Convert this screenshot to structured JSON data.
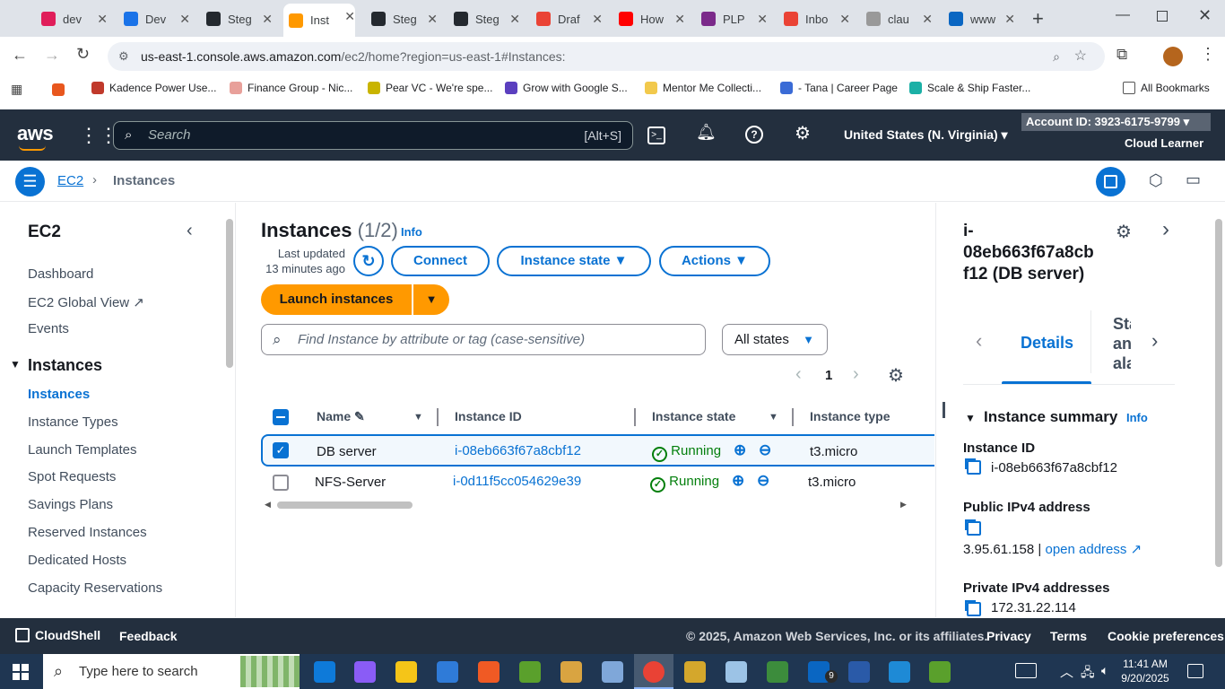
{
  "browser": {
    "tabs": [
      {
        "label": "dev",
        "color": "#e01e5a"
      },
      {
        "label": "Dev",
        "color": "#1a73e8"
      },
      {
        "label": "Steg",
        "color": "#24292f"
      },
      {
        "label": "Inst",
        "color": "#ff9900"
      },
      {
        "label": "Steg",
        "color": "#24292f"
      },
      {
        "label": "Steg",
        "color": "#24292f"
      },
      {
        "label": "Draf",
        "color": "#ea4335"
      },
      {
        "label": "How",
        "color": "#ff0000"
      },
      {
        "label": "PLP",
        "color": "#7b2a8a"
      },
      {
        "label": "Inbo",
        "color": "#ea4335"
      },
      {
        "label": "clau",
        "color": "#999999"
      },
      {
        "label": "www",
        "color": "#0a66c2"
      }
    ],
    "url_host": "us-east-1.console.aws.amazon.com",
    "url_path": "/ec2/home?region=us-east-1#Instances:",
    "bookmarks": [
      {
        "label": "Kadence Power Use...",
        "color": "#c0392b"
      },
      {
        "label": "Finance Group - Nic...",
        "color": "#e8a09a"
      },
      {
        "label": "Pear VC - We're spe...",
        "color": "#c9b400"
      },
      {
        "label": "Grow with Google S...",
        "color": "#5b3fbf"
      },
      {
        "label": "Mentor Me Collecti...",
        "color": "#f2c94c"
      },
      {
        "label": "- Tana | Career Page",
        "color": "#3a6bd6"
      },
      {
        "label": "Scale & Ship Faster...",
        "color": "#1bb0a6"
      }
    ],
    "all_bookmarks": "All Bookmarks"
  },
  "aws": {
    "logo": "aws",
    "search_placeholder": "Search",
    "search_shortcut": "[Alt+S]",
    "region": "United States (N. Virginia)",
    "account_id": "Account ID: 3923-6175-9799",
    "user": "Cloud Learner"
  },
  "breadcrumb": {
    "root": "EC2",
    "current": "Instances"
  },
  "sidebar": {
    "title": "EC2",
    "items": [
      "Dashboard",
      "EC2 Global View",
      "Events"
    ],
    "section": "Instances",
    "section_items": [
      "Instances",
      "Instance Types",
      "Launch Templates",
      "Spot Requests",
      "Savings Plans",
      "Reserved Instances",
      "Dedicated Hosts",
      "Capacity Reservations"
    ]
  },
  "main": {
    "title": "Instances",
    "count": "(1/2)",
    "info": "Info",
    "last_updated_1": "Last updated",
    "last_updated_2": "13 minutes ago",
    "connect": "Connect",
    "instance_state": "Instance state",
    "actions": "Actions",
    "launch": "Launch instances",
    "filter_placeholder": "Find Instance by attribute or tag (case-sensitive)",
    "states_filter": "All states",
    "page": "1",
    "columns": [
      "Name",
      "Instance ID",
      "Instance state",
      "Instance type"
    ],
    "rows": [
      {
        "name": "DB server",
        "id": "i-08eb663f67a8cbf12",
        "state": "Running",
        "type": "t3.micro",
        "selected": true
      },
      {
        "name": "NFS-Server",
        "id": "i-0d11f5cc054629e39",
        "state": "Running",
        "type": "t3.micro",
        "selected": false
      }
    ]
  },
  "panel": {
    "title_1": "i-",
    "title_2": "08eb663f67a8cb",
    "title_3": "f12 (DB server)",
    "tab_details": "Details",
    "tab_next_1": "Stat",
    "tab_next_2": "and",
    "tab_next_3": "alar",
    "summary": "Instance summary",
    "info": "Info",
    "instance_id_label": "Instance ID",
    "instance_id": "i-08eb663f67a8cbf12",
    "public_ip_label": "Public IPv4 address",
    "public_ip": "3.95.61.158",
    "open_address": "open address",
    "private_ip_label": "Private IPv4 addresses",
    "private_ip": "172.31.22.114"
  },
  "footer": {
    "cloudshell": "CloudShell",
    "feedback": "Feedback",
    "copyright": "© 2025, Amazon Web Services, Inc. or its affiliates.",
    "privacy": "Privacy",
    "terms": "Terms",
    "cookies": "Cookie preferences"
  },
  "taskbar": {
    "search_placeholder": "Type here to search",
    "time": "11:41 AM",
    "date": "9/20/2025",
    "badge": "9"
  }
}
